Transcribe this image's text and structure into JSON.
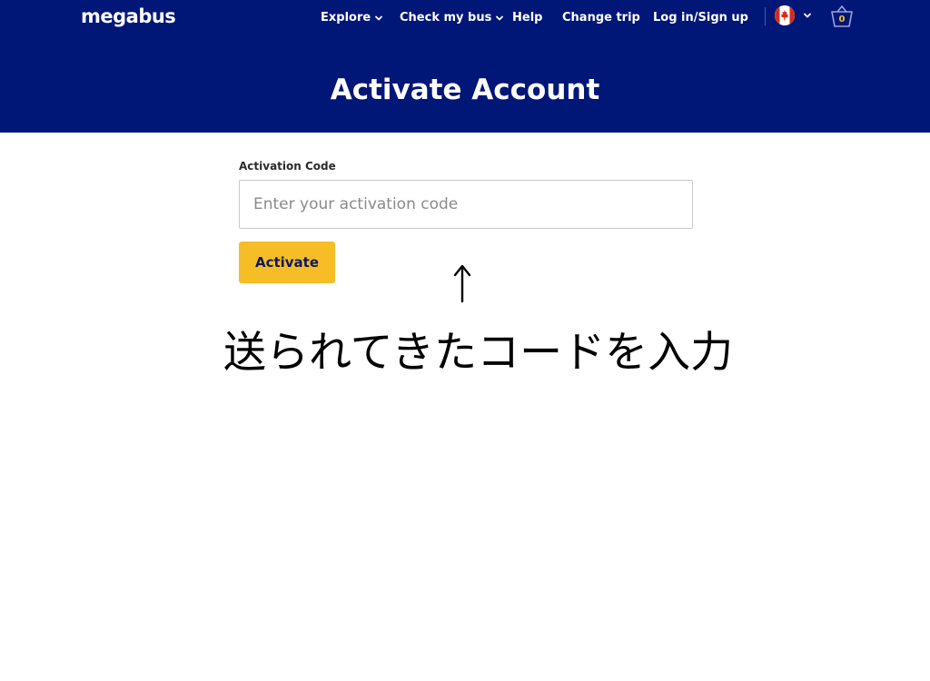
{
  "header": {
    "brand": "megabus",
    "nav": [
      {
        "label": "Explore"
      },
      {
        "label": "Check my bus"
      },
      {
        "label": "Help"
      },
      {
        "label": "Change trip"
      },
      {
        "label": "Log in/Sign up"
      }
    ],
    "basket_count": "0",
    "flag_icon": "canada-flag-icon",
    "colors": {
      "navy": "#001778",
      "accent_yellow": "#f7bd26",
      "flag_red": "#d52b1e"
    }
  },
  "page": {
    "title": "Activate Account"
  },
  "form": {
    "label": "Activation Code",
    "placeholder": "Enter your activation code",
    "value": "",
    "button_label": "Activate"
  },
  "annotation": {
    "arrow": "↑",
    "text": "送られてきたコードを入力"
  }
}
